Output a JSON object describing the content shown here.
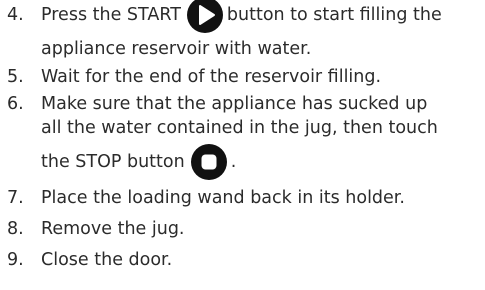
{
  "steps": [
    {
      "number": "4.",
      "line1_before": "Press the START",
      "line1_after": "button to start filling the",
      "line2": "appliance reservoir with water.",
      "icon": "play-icon"
    },
    {
      "number": "5.",
      "line1": "Wait for the end of the reservoir filling."
    },
    {
      "number": "6.",
      "line1": "Make sure that the appliance has sucked up",
      "line2": "all the water contained in the jug, then touch",
      "line3_before": "the STOP button",
      "line3_after": ".",
      "icon": "stop-icon"
    },
    {
      "number": "7.",
      "line1": "Place the loading wand back in its holder."
    },
    {
      "number": "8.",
      "line1": "Remove the jug."
    },
    {
      "number": "9.",
      "line1": "Close the door."
    }
  ],
  "colors": {
    "text": "#2b2b2b",
    "icon_bg": "#111111",
    "icon_fg": "#ffffff"
  }
}
